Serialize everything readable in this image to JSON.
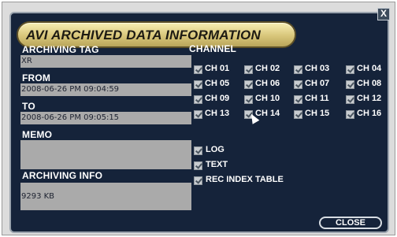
{
  "dialog": {
    "title": "AVI ARCHIVED DATA INFORMATION",
    "close_x": "X",
    "close_label": "CLOSE"
  },
  "left": {
    "archiving_tag_label": "ARCHIVING TAG",
    "archiving_tag_value": "XR",
    "from_label": "FROM",
    "from_value": "2008-06-26  PM  09:04:59",
    "to_label": "TO",
    "to_value": "2008-06-26  PM  09:05:15",
    "memo_label": "MEMO",
    "memo_value": "",
    "archiving_info_label": "ARCHIVING INFO",
    "archiving_info_value": "9293  KB"
  },
  "channels": {
    "label": "CHANNEL",
    "items": [
      "CH 01",
      "CH 02",
      "CH 03",
      "CH 04",
      "CH 05",
      "CH 06",
      "CH 07",
      "CH 08",
      "CH 09",
      "CH 10",
      "CH 11",
      "CH 12",
      "CH 13",
      "CH 14",
      "CH 15",
      "CH 16"
    ]
  },
  "options": {
    "items": [
      "LOG",
      "TEXT",
      "REC INDEX TABLE"
    ]
  }
}
